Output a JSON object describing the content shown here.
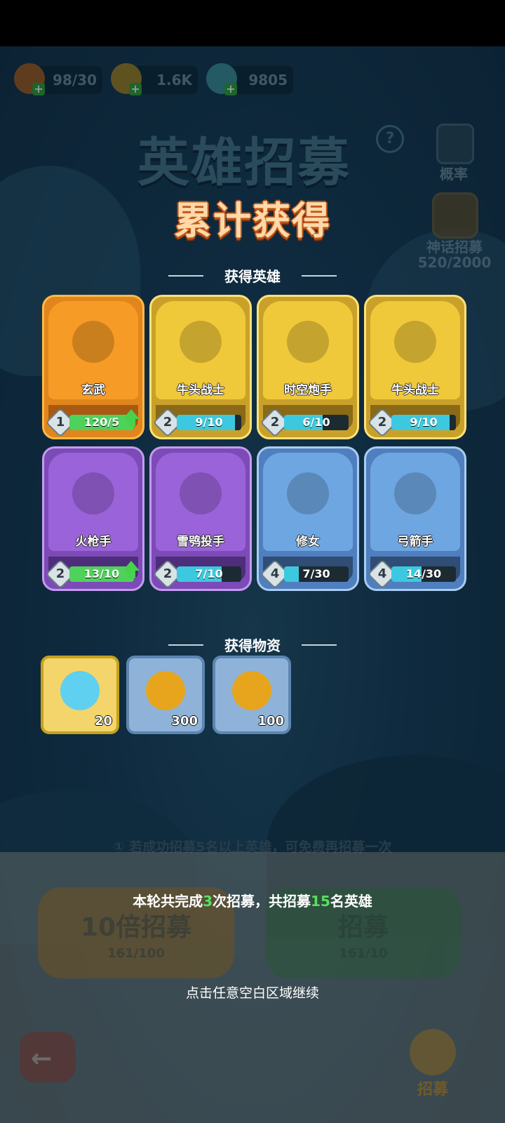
{
  "resources": {
    "energy": "98/30",
    "gold": "1.6K",
    "crystal": "9805"
  },
  "header": {
    "title": "英雄招募",
    "probability_label": "概率",
    "mythic_label": "神话招募",
    "mythic_count": "520/2000"
  },
  "result": {
    "title": "累计获得",
    "heroes_section": "获得英雄",
    "items_section": "获得物资",
    "heroes": [
      {
        "name": "玄武",
        "level": "1",
        "progress_text": "120/5",
        "progress": 1.0,
        "upgrade": true,
        "rarity": "orange"
      },
      {
        "name": "牛头战士",
        "level": "2",
        "progress_text": "9/10",
        "progress": 0.9,
        "upgrade": false,
        "rarity": "gold"
      },
      {
        "name": "时空炮手",
        "level": "2",
        "progress_text": "6/10",
        "progress": 0.6,
        "upgrade": false,
        "rarity": "gold"
      },
      {
        "name": "牛头战士",
        "level": "2",
        "progress_text": "9/10",
        "progress": 0.9,
        "upgrade": false,
        "rarity": "gold"
      },
      {
        "name": "火枪手",
        "level": "2",
        "progress_text": "13/10",
        "progress": 1.0,
        "upgrade": true,
        "rarity": "purple"
      },
      {
        "name": "雪鸮投手",
        "level": "2",
        "progress_text": "7/10",
        "progress": 0.7,
        "upgrade": false,
        "rarity": "purple"
      },
      {
        "name": "修女",
        "level": "4",
        "progress_text": "7/30",
        "progress": 0.2333,
        "upgrade": false,
        "rarity": "blue"
      },
      {
        "name": "弓箭手",
        "level": "4",
        "progress_text": "14/30",
        "progress": 0.4667,
        "upgrade": false,
        "rarity": "blue"
      }
    ],
    "items": [
      {
        "icon": "crystal-icon",
        "qty": "20",
        "frame": "gold"
      },
      {
        "icon": "gold-coin-icon",
        "qty": "300",
        "frame": "blue"
      },
      {
        "icon": "gold-coin-icon",
        "qty": "100",
        "frame": "blue"
      }
    ],
    "summary_prefix": "本轮共完成",
    "summary_times": "3",
    "summary_mid": "次招募，共招募",
    "summary_count": "15",
    "summary_suffix": "名英雄",
    "continue_hint": "点击任意空白区域继续"
  },
  "background": {
    "tip": "① 若成功招募5名以上英雄，可免费再招募一次",
    "btn_10x_label": "10倍招募",
    "btn_10x_cost": "161/100",
    "btn_recruit_label": "招募",
    "btn_recruit_cost": "161/10",
    "bottom_recruit_label": "招募"
  },
  "colors": {
    "highlight_green": "#56e060",
    "title_orange": "#c0571b",
    "progress_cyan": "#3cc9e0",
    "progress_green": "#4fd25b"
  }
}
